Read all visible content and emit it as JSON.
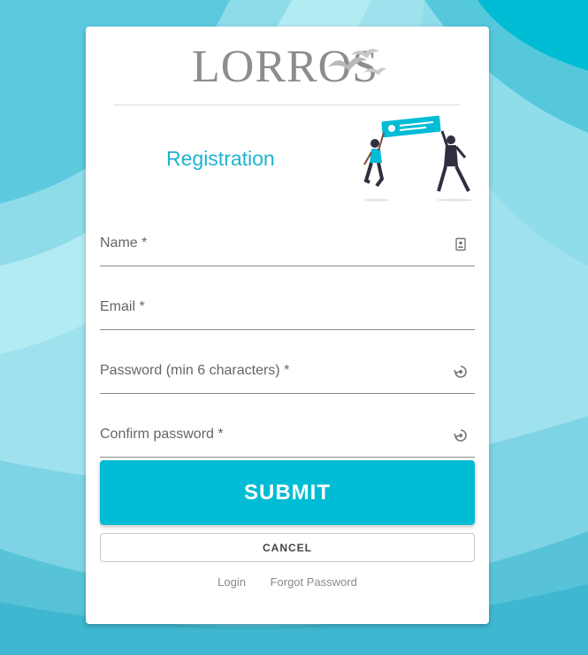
{
  "brand": {
    "logo_text": "LORROS"
  },
  "page": {
    "title": "Registration"
  },
  "form": {
    "name": {
      "label": "Name *",
      "icon": "contact-card-icon"
    },
    "email": {
      "label": "Email *"
    },
    "password": {
      "label": "Password (min 6 characters) *",
      "icon": "password-visibility-icon"
    },
    "confirm_password": {
      "label": "Confirm password *",
      "icon": "password-visibility-icon"
    },
    "submit_label": "SUBMIT",
    "cancel_label": "CANCEL"
  },
  "footer_links": {
    "login": "Login",
    "forgot_password": "Forgot Password"
  },
  "colors": {
    "accent": "#00bcd4",
    "title": "#1fb3cf",
    "background_wave": "#7fd6e6"
  }
}
